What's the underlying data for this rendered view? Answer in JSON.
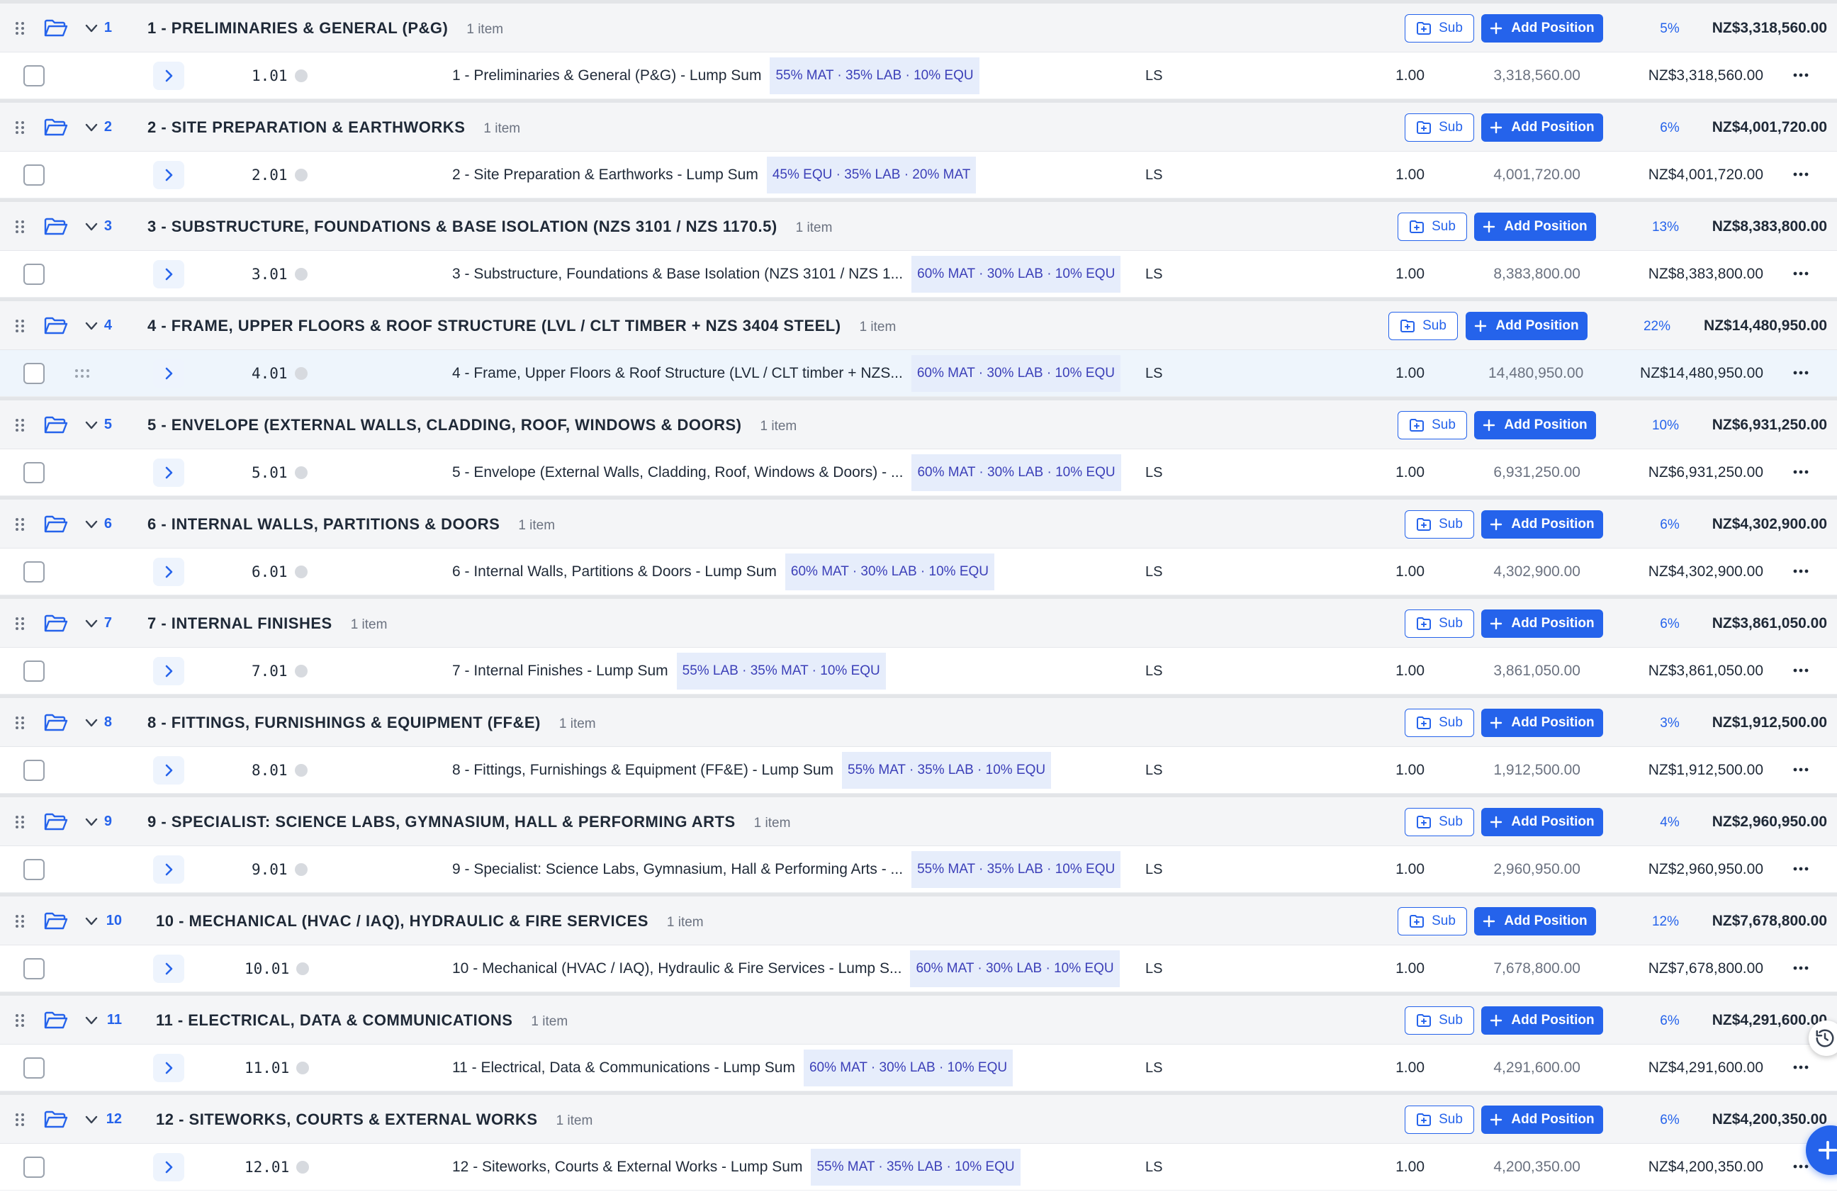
{
  "labels": {
    "sub": "Sub",
    "add_position": "Add Position"
  },
  "icons": {
    "drag": "drag-handle-icon",
    "folder": "folder-open-icon",
    "collapse": "chevron-down-icon",
    "expand": "chevron-right-icon",
    "grip": "grip-dots-icon",
    "more": "more-horizontal-icon",
    "sub": "add-subfolder-icon",
    "add": "plus-icon",
    "history": "history-icon",
    "fab": "plus-icon"
  },
  "colors": {
    "accent": "#2563eb",
    "badge_bg": "#e6edfb",
    "badge_text": "#3b3fb8",
    "highlight_row": "#eef5fc"
  },
  "groups": [
    {
      "num": "1",
      "title": "1 - PRELIMINARIES & GENERAL (P&G)",
      "count": "1 item",
      "pct": "5%",
      "total": "NZ$3,318,560.00",
      "position": {
        "code": "1.01",
        "description": "1 - Preliminaries & General (P&G) - Lump Sum",
        "badge": "55% MAT · 35% LAB · 10% EQU",
        "unit": "LS",
        "qty": "1.00",
        "rate": "3,318,560.00",
        "amount": "NZ$3,318,560.00"
      }
    },
    {
      "num": "2",
      "title": "2 - SITE PREPARATION & EARTHWORKS",
      "count": "1 item",
      "pct": "6%",
      "total": "NZ$4,001,720.00",
      "position": {
        "code": "2.01",
        "description": "2 - Site Preparation & Earthworks - Lump Sum",
        "badge": "45% EQU · 35% LAB · 20% MAT",
        "unit": "LS",
        "qty": "1.00",
        "rate": "4,001,720.00",
        "amount": "NZ$4,001,720.00"
      }
    },
    {
      "num": "3",
      "title": "3 - SUBSTRUCTURE, FOUNDATIONS & BASE ISOLATION (NZS 3101 / NZS 1170.5)",
      "count": "1 item",
      "pct": "13%",
      "total": "NZ$8,383,800.00",
      "position": {
        "code": "3.01",
        "description": "3 - Substructure, Foundations & Base Isolation (NZS 3101 / NZS 1...",
        "badge": "60% MAT · 30% LAB · 10% EQU",
        "unit": "LS",
        "qty": "1.00",
        "rate": "8,383,800.00",
        "amount": "NZ$8,383,800.00"
      }
    },
    {
      "num": "4",
      "title": "4 - FRAME, UPPER FLOORS & ROOF STRUCTURE (LVL / CLT TIMBER + NZS 3404 STEEL)",
      "count": "1 item",
      "pct": "22%",
      "total": "NZ$14,480,950.00",
      "position": {
        "code": "4.01",
        "description": "4 - Frame, Upper Floors & Roof Structure (LVL / CLT timber + NZS...",
        "badge": "60% MAT · 30% LAB · 10% EQU",
        "unit": "LS",
        "qty": "1.00",
        "rate": "14,480,950.00",
        "amount": "NZ$14,480,950.00"
      }
    },
    {
      "num": "5",
      "title": "5 - ENVELOPE (EXTERNAL WALLS, CLADDING, ROOF, WINDOWS & DOORS)",
      "count": "1 item",
      "pct": "10%",
      "total": "NZ$6,931,250.00",
      "position": {
        "code": "5.01",
        "description": "5 - Envelope (External Walls, Cladding, Roof, Windows & Doors) - ...",
        "badge": "60% MAT · 30% LAB · 10% EQU",
        "unit": "LS",
        "qty": "1.00",
        "rate": "6,931,250.00",
        "amount": "NZ$6,931,250.00"
      }
    },
    {
      "num": "6",
      "title": "6 - INTERNAL WALLS, PARTITIONS & DOORS",
      "count": "1 item",
      "pct": "6%",
      "total": "NZ$4,302,900.00",
      "position": {
        "code": "6.01",
        "description": "6 - Internal Walls, Partitions & Doors - Lump Sum",
        "badge": "60% MAT · 30% LAB · 10% EQU",
        "unit": "LS",
        "qty": "1.00",
        "rate": "4,302,900.00",
        "amount": "NZ$4,302,900.00"
      }
    },
    {
      "num": "7",
      "title": "7 - INTERNAL FINISHES",
      "count": "1 item",
      "pct": "6%",
      "total": "NZ$3,861,050.00",
      "position": {
        "code": "7.01",
        "description": "7 - Internal Finishes - Lump Sum",
        "badge": "55% LAB · 35% MAT · 10% EQU",
        "unit": "LS",
        "qty": "1.00",
        "rate": "3,861,050.00",
        "amount": "NZ$3,861,050.00"
      }
    },
    {
      "num": "8",
      "title": "8 - FITTINGS, FURNISHINGS & EQUIPMENT (FF&E)",
      "count": "1 item",
      "pct": "3%",
      "total": "NZ$1,912,500.00",
      "position": {
        "code": "8.01",
        "description": "8 - Fittings, Furnishings & Equipment (FF&E) - Lump Sum",
        "badge": "55% MAT · 35% LAB · 10% EQU",
        "unit": "LS",
        "qty": "1.00",
        "rate": "1,912,500.00",
        "amount": "NZ$1,912,500.00"
      }
    },
    {
      "num": "9",
      "title": "9 - SPECIALIST: SCIENCE LABS, GYMNASIUM, HALL & PERFORMING ARTS",
      "count": "1 item",
      "pct": "4%",
      "total": "NZ$2,960,950.00",
      "position": {
        "code": "9.01",
        "description": "9 - Specialist: Science Labs, Gymnasium, Hall & Performing Arts - ...",
        "badge": "55% MAT · 35% LAB · 10% EQU",
        "unit": "LS",
        "qty": "1.00",
        "rate": "2,960,950.00",
        "amount": "NZ$2,960,950.00"
      }
    },
    {
      "num": "10",
      "title": "10 - MECHANICAL (HVAC / IAQ), HYDRAULIC & FIRE SERVICES",
      "count": "1 item",
      "pct": "12%",
      "total": "NZ$7,678,800.00",
      "position": {
        "code": "10.01",
        "description": "10 - Mechanical (HVAC / IAQ), Hydraulic & Fire Services - Lump S...",
        "badge": "60% MAT · 30% LAB · 10% EQU",
        "unit": "LS",
        "qty": "1.00",
        "rate": "7,678,800.00",
        "amount": "NZ$7,678,800.00"
      }
    },
    {
      "num": "11",
      "title": "11 - ELECTRICAL, DATA & COMMUNICATIONS",
      "count": "1 item",
      "pct": "6%",
      "total": "NZ$4,291,600.00",
      "position": {
        "code": "11.01",
        "description": "11 - Electrical, Data & Communications - Lump Sum",
        "badge": "60% MAT · 30% LAB · 10% EQU",
        "unit": "LS",
        "qty": "1.00",
        "rate": "4,291,600.00",
        "amount": "NZ$4,291,600.00"
      }
    },
    {
      "num": "12",
      "title": "12 - SITEWORKS, COURTS & EXTERNAL WORKS",
      "count": "1 item",
      "pct": "6%",
      "total": "NZ$4,200,350.00",
      "position": {
        "code": "12.01",
        "description": "12 - Siteworks, Courts & External Works - Lump Sum",
        "badge": "55% MAT · 35% LAB · 10% EQU",
        "unit": "LS",
        "qty": "1.00",
        "rate": "4,200,350.00",
        "amount": "NZ$4,200,350.00"
      }
    }
  ]
}
